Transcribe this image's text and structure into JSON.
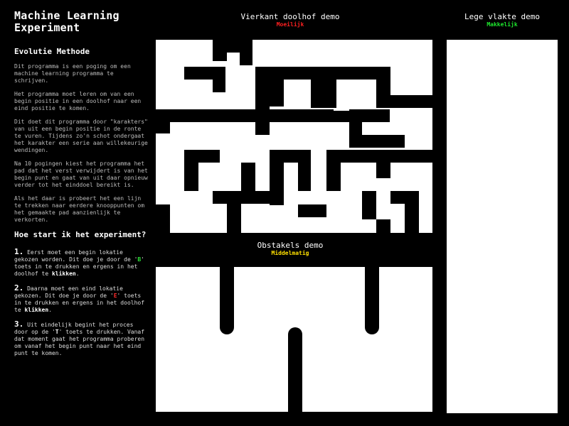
{
  "sidebar": {
    "title": "Machine Learning Experiment",
    "method_heading": "Evolutie Methode",
    "paragraphs": [
      "Dit programma is een poging om een machine learning programma te schrijven.",
      "Het programma moet leren om van een begin positie in een doolhof naar een eind positie te komen.",
      "Dit doet dit programma door \"karakters\" van uit een begin positie in de ronte te vuren. Tijdens zo'n schot ondergaat het karakter een serie aan willekeurige wendingen.",
      "Na 10 pogingen kiest het programma het pad dat het verst verwijdert is van het begin punt en gaat van uit daar opnieuw verder tot het einddoel bereikt is.",
      "Als het daar is probeert het een lijn te trekken naar eerdere knooppunten om het gemaakte pad aanzienlijk te verkorten."
    ],
    "start_heading": "Hoe start ik het experiment?",
    "steps": [
      {
        "num": "1.",
        "pre": "Eerst moet een begin lokatie gekozen worden. Dit doe je door de '",
        "key": "B",
        "mid": "' toets in te drukken en ergens in het doolhof te ",
        "action": "klikken",
        "post": "."
      },
      {
        "num": "2.",
        "pre": "Daarna moet een eind lokatie gekozen. Dit doe je door de '",
        "key": "E",
        "mid": "' toets in te drukken en ergens in het doolhof te ",
        "action": "klikken",
        "post": "."
      },
      {
        "num": "3.",
        "pre": "Uit eindelijk begint het proces door op de '",
        "key": "T",
        "mid": "' toets te drukken. Vanaf dat moment gaat het programma proberen om vanaf het begin punt naar het eind punt te komen.",
        "action": "",
        "post": ""
      }
    ]
  },
  "demos": {
    "square_maze": {
      "name": "Vierkant doolhof demo",
      "difficulty": "Moeilijk"
    },
    "empty_plane": {
      "name": "Lege vlakte demo",
      "difficulty": "Makkelijk"
    },
    "obstacles": {
      "name": "Obstakels demo",
      "difficulty": "Middelmatig"
    }
  },
  "colors": {
    "background": "#000000",
    "panel": "#ffffff",
    "hard": "#ff2020",
    "easy": "#1ee82e",
    "medium": "#ffe000",
    "key_b": "#2ee83a",
    "key_e": "#ff2b2b"
  }
}
